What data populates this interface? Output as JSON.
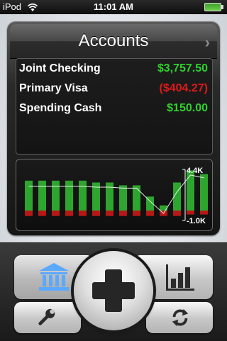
{
  "status": {
    "carrier": "iPod",
    "time": "11:01 AM"
  },
  "panel": {
    "title": "Accounts"
  },
  "accounts": [
    {
      "name": "Joint Checking",
      "amount": "$3,757.50",
      "color": "#2fd12f"
    },
    {
      "name": "Primary Visa",
      "amount": "($404.27)",
      "color": "#e01a1a"
    },
    {
      "name": "Spending Cash",
      "amount": "$150.00",
      "color": "#2fd12f"
    }
  ],
  "chart_data": {
    "type": "bar",
    "y_labels": {
      "max": "4.4K",
      "min": "-1.0K"
    },
    "series": [
      {
        "positive": [
          3.2,
          3.2,
          3.2,
          3.2,
          3.2,
          3.0,
          3.0,
          2.7,
          2.7,
          1.5,
          0.55,
          3.0,
          4.3,
          3.9
        ],
        "negative": [
          0.55,
          0.55,
          0.55,
          0.55,
          0.55,
          0.55,
          0.55,
          0.55,
          0.55,
          0.55,
          0.55,
          0.55,
          0.4,
          0.4
        ]
      }
    ],
    "trend": [
      2.6,
      2.6,
      2.6,
      2.6,
      2.6,
      2.5,
      2.5,
      2.4,
      2.4,
      1.0,
      -0.3,
      2.0,
      3.8,
      3.5
    ],
    "colors": {
      "positive": "#2ea52e",
      "negative": "#b71717",
      "line": "#ffffff"
    }
  },
  "dock": {
    "accounts_icon": "bank-icon",
    "add_icon": "plus-icon",
    "reports_icon": "bar-chart-icon",
    "settings_icon": "wrench-icon",
    "sync_icon": "refresh-icon"
  }
}
